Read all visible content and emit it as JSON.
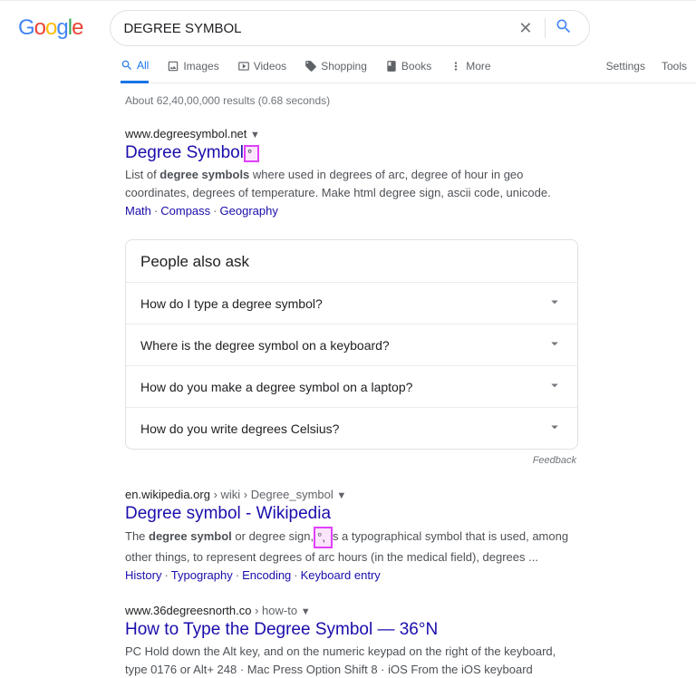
{
  "search": {
    "query": "DEGREE SYMBOL",
    "placeholder": ""
  },
  "tabs": {
    "all": "All",
    "images": "Images",
    "videos": "Videos",
    "shopping": "Shopping",
    "books": "Books",
    "more": "More"
  },
  "nav_right": {
    "settings": "Settings",
    "tools": "Tools"
  },
  "stats": "About 62,40,00,000 results (0.68 seconds)",
  "r1": {
    "url": "www.degreesymbol.net",
    "title": "Degree Symbol",
    "hl": "°",
    "snip1": "List of ",
    "snipb": "degree symbols",
    "snip2": " where used in degrees of arc, degree of hour in geo coordinates, degrees of temperature. Make html degree sign, ascii code, unicode.",
    "links": [
      "Math",
      "Compass",
      "Geography"
    ]
  },
  "paa": {
    "title": "People also ask",
    "q": [
      "How do I type a degree symbol?",
      "Where is the degree symbol on a keyboard?",
      "How do you make a degree symbol on a laptop?",
      "How do you write degrees Celsius?"
    ]
  },
  "feedback": "Feedback",
  "r2": {
    "url": "en.wikipedia.org",
    "crumb": " › wiki › Degree_symbol",
    "title": "Degree symbol - Wikipedia",
    "s1": "The ",
    "sb": "degree symbol",
    "s2": " or degree sign,",
    "hl": "°,",
    "s3": "s a typographical symbol that is used, among other things, to represent degrees of arc hours (in the medical field), degrees ...",
    "links": [
      "History",
      "Typography",
      "Encoding",
      "Keyboard entry"
    ]
  },
  "r3": {
    "url": "www.36degreesnorth.co",
    "crumb": " › how-to",
    "title": "How to Type the Degree Symbol — 36°N",
    "snip": "PC Hold down the Alt key, and on the numeric keypad on the right of the keyboard, type 0176 or Alt+ 248 · Mac Press Option Shift 8 · iOS From the iOS keyboard"
  }
}
